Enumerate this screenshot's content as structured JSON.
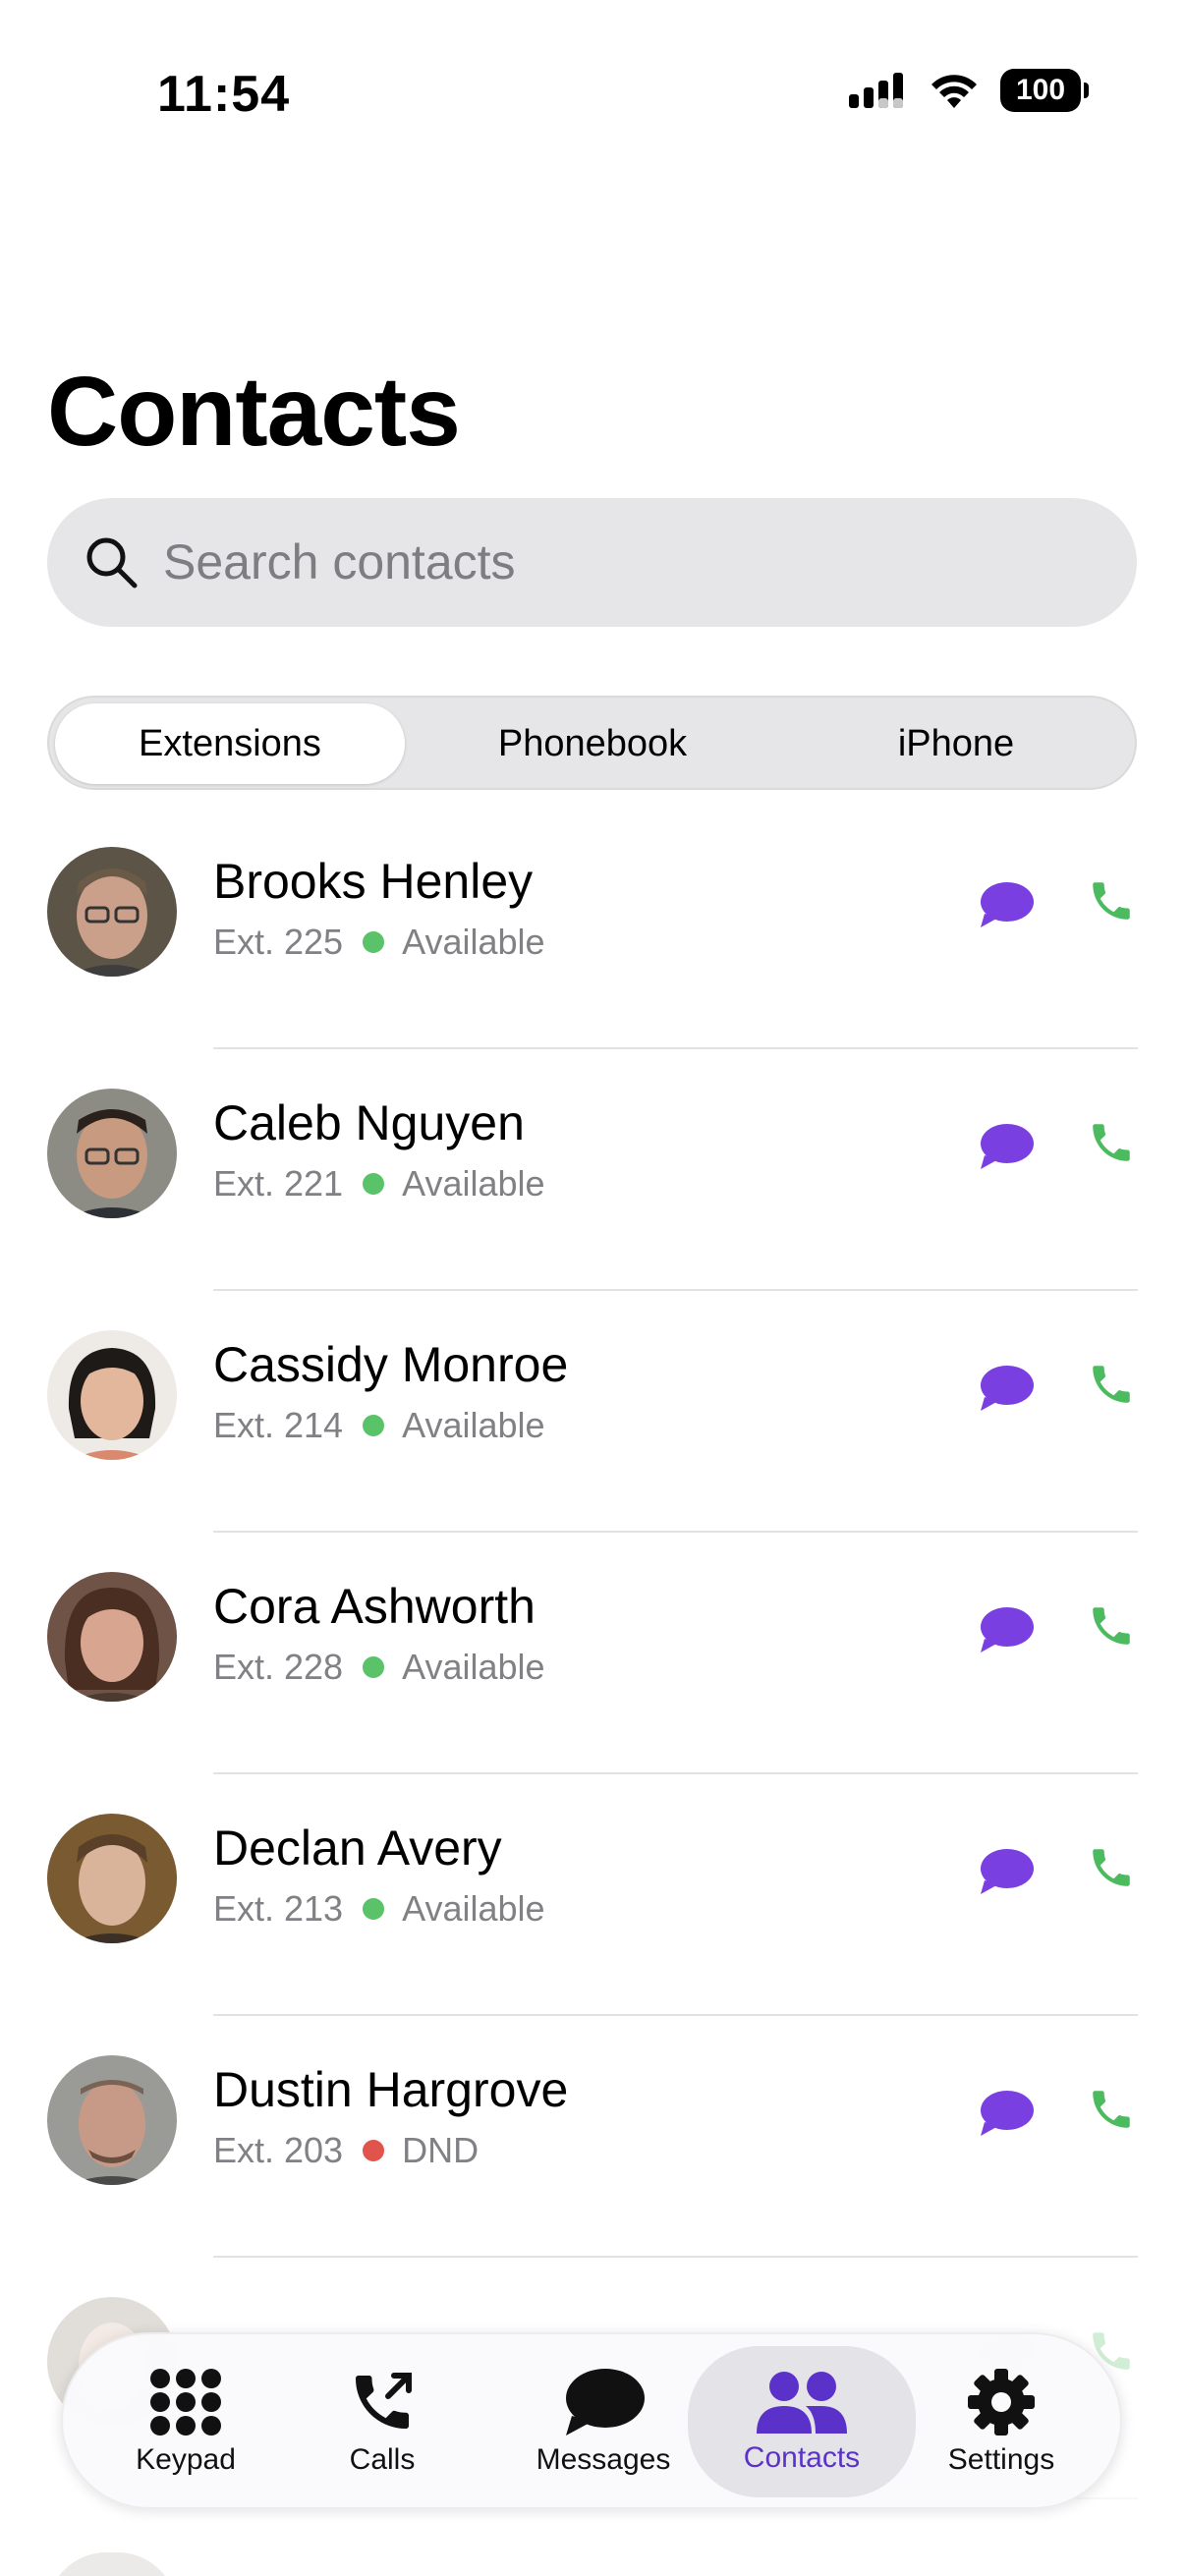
{
  "status_bar": {
    "time": "11:54",
    "battery": "100"
  },
  "page": {
    "title": "Contacts"
  },
  "search": {
    "placeholder": "Search contacts"
  },
  "segments": [
    {
      "label": "Extensions",
      "selected": true
    },
    {
      "label": "Phonebook",
      "selected": false
    },
    {
      "label": "iPhone",
      "selected": false
    }
  ],
  "contacts": [
    {
      "name": "Brooks Henley",
      "ext": "Ext. 225",
      "status": "Available",
      "status_color": "#5ac36a"
    },
    {
      "name": "Caleb Nguyen",
      "ext": "Ext. 221",
      "status": "Available",
      "status_color": "#5ac36a"
    },
    {
      "name": "Cassidy Monroe",
      "ext": "Ext. 214",
      "status": "Available",
      "status_color": "#5ac36a"
    },
    {
      "name": "Cora Ashworth",
      "ext": "Ext. 228",
      "status": "Available",
      "status_color": "#5ac36a"
    },
    {
      "name": "Declan Avery",
      "ext": "Ext. 213",
      "status": "Available",
      "status_color": "#5ac36a"
    },
    {
      "name": "Dustin Hargrove",
      "ext": "Ext. 203",
      "status": "DND",
      "status_color": "#e0544c"
    }
  ],
  "tabs": [
    {
      "label": "Keypad",
      "icon": "keypad-icon"
    },
    {
      "label": "Calls",
      "icon": "calls-icon"
    },
    {
      "label": "Messages",
      "icon": "messages-icon"
    },
    {
      "label": "Contacts",
      "icon": "contacts-icon",
      "active": true
    },
    {
      "label": "Settings",
      "icon": "gear-icon"
    }
  ],
  "colors": {
    "accent": "#5b32c9",
    "message_icon": "#7a3fe0",
    "call_icon": "#4cbb5f"
  }
}
